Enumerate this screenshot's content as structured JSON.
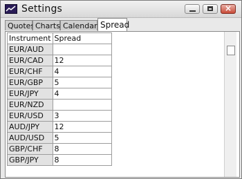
{
  "window": {
    "title": "Settings"
  },
  "tabs": [
    {
      "label": "Quotes"
    },
    {
      "label": "Charts"
    },
    {
      "label": "Calendar"
    },
    {
      "label": "Spread"
    }
  ],
  "table": {
    "headers": [
      "Instrument",
      "Spread"
    ],
    "rows": [
      {
        "instrument": "EUR/AUD",
        "spread": ""
      },
      {
        "instrument": "EUR/CAD",
        "spread": "12"
      },
      {
        "instrument": "EUR/CHF",
        "spread": "4"
      },
      {
        "instrument": "EUR/GBP",
        "spread": "5"
      },
      {
        "instrument": "EUR/JPY",
        "spread": "4"
      },
      {
        "instrument": "EUR/NZD",
        "spread": ""
      },
      {
        "instrument": "EUR/USD",
        "spread": "3"
      },
      {
        "instrument": "AUD/JPY",
        "spread": "12"
      },
      {
        "instrument": "AUD/USD",
        "spread": "5"
      },
      {
        "instrument": "GBP/CHF",
        "spread": "8"
      },
      {
        "instrument": "GBP/JPY",
        "spread": "8"
      }
    ]
  }
}
